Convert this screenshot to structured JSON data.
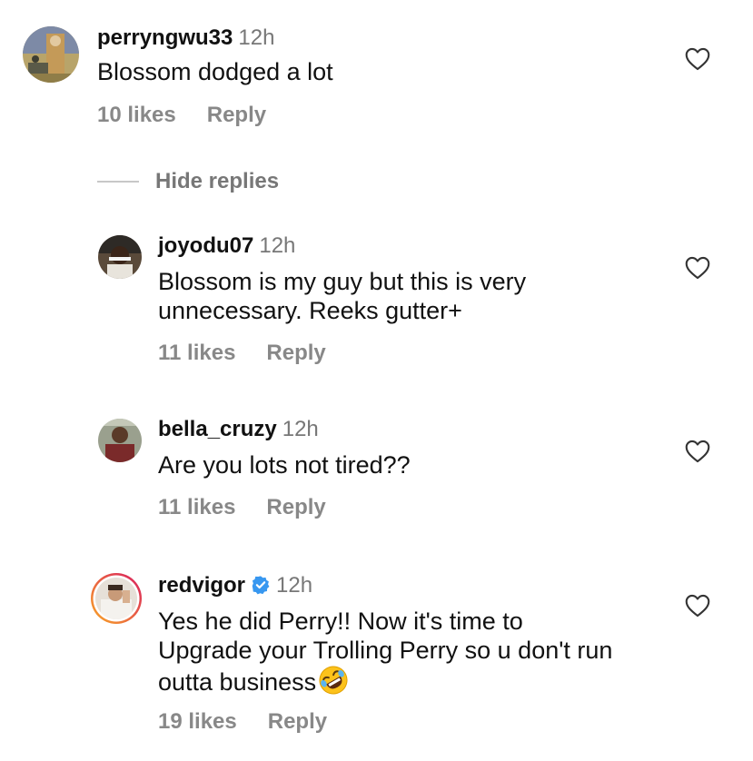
{
  "comments": [
    {
      "username": "perryngwu33",
      "time": "12h",
      "text": "Blossom dodged a lot",
      "likes": "10 likes",
      "reply": "Reply"
    }
  ],
  "hide_replies": "Hide replies",
  "replies": [
    {
      "username": "joyodu07",
      "time": "12h",
      "text": "Blossom is my guy but this is very\nunnecessary. Reeks gutter+",
      "likes": "11 likes",
      "reply": "Reply"
    },
    {
      "username": "bella_cruzy",
      "time": "12h",
      "text": "Are you lots not tired??",
      "likes": "11 likes",
      "reply": "Reply"
    },
    {
      "username": "redvigor",
      "time": "12h",
      "verified": true,
      "text": "Yes he did Perry!! Now it's time to\nUpgrade your Trolling Perry so u don't run\noutta business",
      "emoji": "rolling-on-floor-laughing-emoji",
      "likes": "19 likes",
      "reply": "Reply"
    }
  ],
  "colors": {
    "username": "#111111",
    "time": "#777777",
    "meta": "#888888",
    "verified": "#3797f0",
    "story_ring_start": "#f9a825",
    "story_ring_end": "#d81b60"
  }
}
